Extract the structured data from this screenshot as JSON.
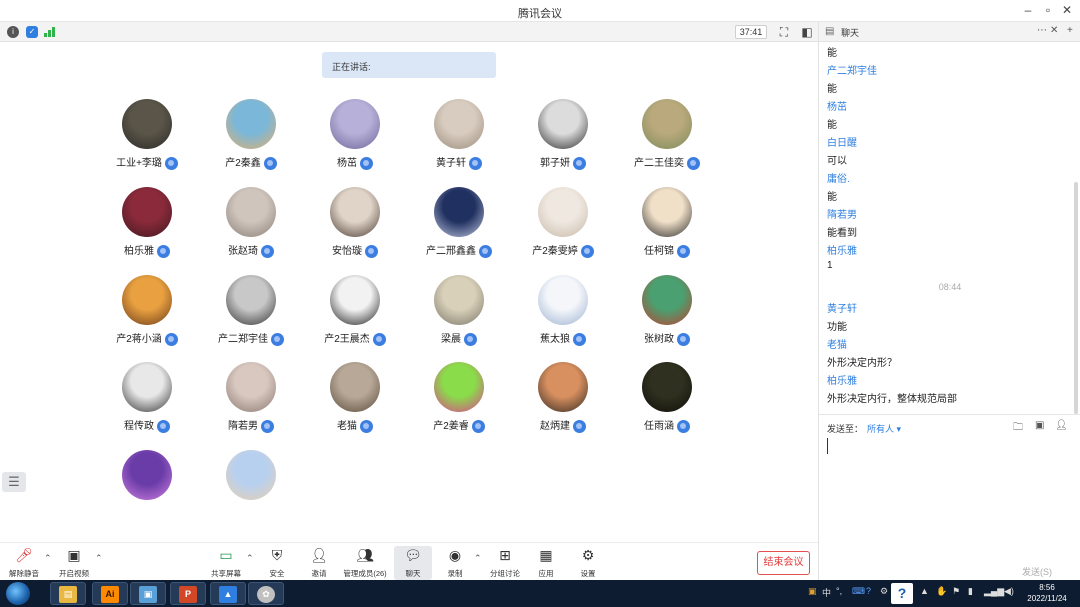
{
  "window": {
    "title": "腾讯会议"
  },
  "status": {
    "timer": "37:41"
  },
  "speaking": {
    "label": "正在讲话:"
  },
  "participants": [
    {
      "name": "工业+李璐",
      "colors": [
        "#5a5548",
        "#2b2a28"
      ]
    },
    {
      "name": "产2秦鑫",
      "colors": [
        "#7ab7d9",
        "#e0b070"
      ]
    },
    {
      "name": "杨茁",
      "colors": [
        "#b7b0d8",
        "#6c6498"
      ]
    },
    {
      "name": "黄子轩",
      "colors": [
        "#d8ccc0",
        "#9a8c7a"
      ]
    },
    {
      "name": "郭子妍",
      "colors": [
        "#dcdcdc",
        "#2a2a2a"
      ]
    },
    {
      "name": "产二王佳奕",
      "colors": [
        "#b9a97c",
        "#7c8a5a"
      ]
    },
    {
      "name": "柏乐雅",
      "colors": [
        "#8a2a3a",
        "#401820"
      ]
    },
    {
      "name": "张赵琦",
      "colors": [
        "#cfc5bd",
        "#8b7f75"
      ]
    },
    {
      "name": "安怡璇",
      "colors": [
        "#e0d4c8",
        "#4a3a30"
      ]
    },
    {
      "name": "产二邢鑫鑫",
      "colors": [
        "#203060",
        "#c0c8e0"
      ]
    },
    {
      "name": "产2秦雯婷",
      "colors": [
        "#efe8e0",
        "#c8b8a8"
      ]
    },
    {
      "name": "任柯锦",
      "colors": [
        "#f0e0c8",
        "#2a2a2a"
      ]
    },
    {
      "name": "产2蒋小涵",
      "colors": [
        "#e8a040",
        "#6a3a18"
      ]
    },
    {
      "name": "产二郑宇佳",
      "colors": [
        "#c8c8c8",
        "#303030"
      ]
    },
    {
      "name": "产2王晨杰",
      "colors": [
        "#f2f2f2",
        "#1a1a1a"
      ]
    },
    {
      "name": "梁晨",
      "colors": [
        "#d8d0b8",
        "#7a7468"
      ]
    },
    {
      "name": "蕉太狼",
      "colors": [
        "#f4f6fa",
        "#9ab0d0"
      ]
    },
    {
      "name": "张树政",
      "colors": [
        "#4aa070",
        "#c04030"
      ]
    },
    {
      "name": "程传政",
      "colors": [
        "#e8e8e8",
        "#303030"
      ]
    },
    {
      "name": "隋若男",
      "colors": [
        "#d8c8c0",
        "#8a7870"
      ]
    },
    {
      "name": "老猫",
      "colors": [
        "#b8a898",
        "#5a4a3a"
      ]
    },
    {
      "name": "产2姜睿",
      "colors": [
        "#8adc4a",
        "#e04090"
      ]
    },
    {
      "name": "赵炳建",
      "colors": [
        "#d89060",
        "#302820"
      ]
    },
    {
      "name": "任雨涵",
      "colors": [
        "#303020",
        "#0e0e08"
      ]
    },
    {
      "name": "",
      "colors": [
        "#6a3ca8",
        "#d080e0"
      ]
    },
    {
      "name": "",
      "colors": [
        "#b8d0f0",
        "#e8d0b0"
      ]
    }
  ],
  "toolbar": {
    "unmute": "解除静音",
    "video": "开启视频",
    "share": "共享屏幕",
    "security": "安全",
    "invite": "邀请",
    "members": "管理成员(26)",
    "chat": "聊天",
    "record": "录制",
    "breakout": "分组讨论",
    "apps": "应用",
    "settings": "设置",
    "end": "结束会议"
  },
  "chat": {
    "title": "聊天",
    "messages": [
      {
        "kind": "text",
        "value": "能"
      },
      {
        "kind": "sender",
        "value": "产二郑宇佳"
      },
      {
        "kind": "text",
        "value": "能"
      },
      {
        "kind": "sender",
        "value": "杨茁"
      },
      {
        "kind": "text",
        "value": "能"
      },
      {
        "kind": "sender",
        "value": "白日醒"
      },
      {
        "kind": "text",
        "value": "可以"
      },
      {
        "kind": "sender",
        "value": "庸俗."
      },
      {
        "kind": "text",
        "value": "能"
      },
      {
        "kind": "sender",
        "value": "隋若男"
      },
      {
        "kind": "text",
        "value": "能看到"
      },
      {
        "kind": "sender",
        "value": "柏乐雅"
      },
      {
        "kind": "text",
        "value": "1"
      },
      {
        "kind": "time",
        "value": "08:44"
      },
      {
        "kind": "sender",
        "value": "黄子轩"
      },
      {
        "kind": "text",
        "value": "功能"
      },
      {
        "kind": "sender",
        "value": "老猫"
      },
      {
        "kind": "text",
        "value": "外形决定内形？"
      },
      {
        "kind": "sender",
        "value": "柏乐雅"
      },
      {
        "kind": "text",
        "value": "外形决定内行，整体规范局部"
      }
    ],
    "send_to_label": "发送至：",
    "send_to_value": "所有人",
    "send_button": "发送(S)"
  },
  "taskbar": {
    "lang": "中",
    "time": "8:56",
    "date": "2022/11/24"
  }
}
